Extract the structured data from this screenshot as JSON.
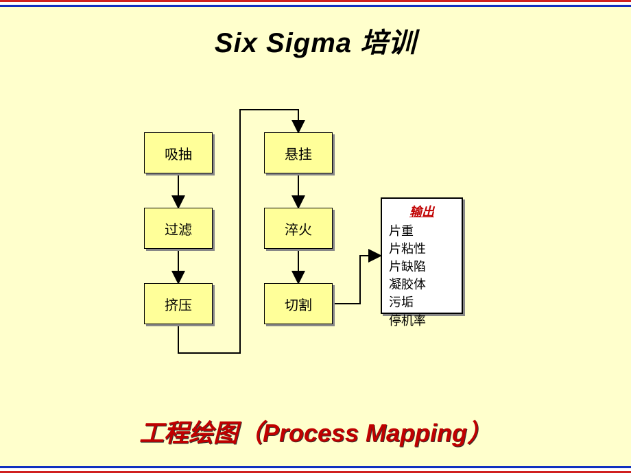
{
  "title": "Six  Sigma 培训",
  "subtitle": "工程绘图（Process Mapping）",
  "boxes": {
    "b1": "吸抽",
    "b2": "过滤",
    "b3": "挤压",
    "b4": "悬挂",
    "b5": "淬火",
    "b6": "切割"
  },
  "output": {
    "header": "输出",
    "items": [
      "片重",
      "片粘性",
      "片缺陷",
      "凝胶体",
      "污垢",
      "停机率"
    ]
  }
}
